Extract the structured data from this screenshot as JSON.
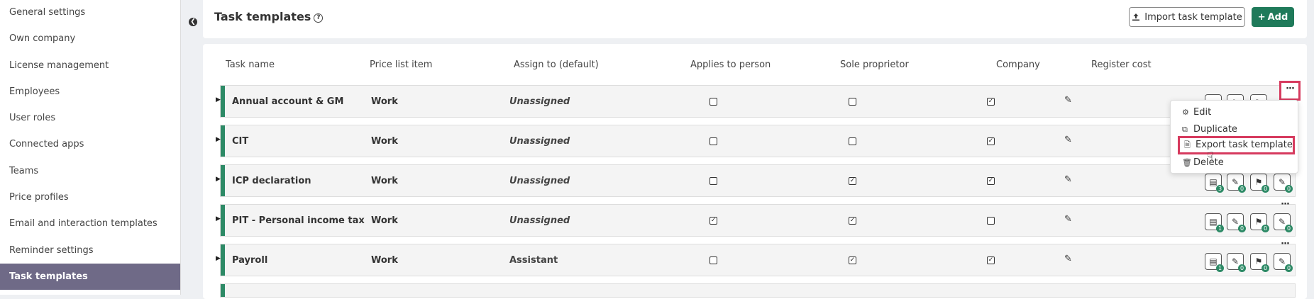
{
  "sidebar": {
    "items": [
      {
        "label": "General settings",
        "active": false
      },
      {
        "label": "Own company",
        "active": false
      },
      {
        "label": "License management",
        "active": false
      },
      {
        "label": "Employees",
        "active": false
      },
      {
        "label": "User roles",
        "active": false
      },
      {
        "label": "Connected apps",
        "active": false
      },
      {
        "label": "Teams",
        "active": false
      },
      {
        "label": "Price profiles",
        "active": false
      },
      {
        "label": "Email and interaction templates",
        "active": false
      },
      {
        "label": "Reminder settings",
        "active": false
      },
      {
        "label": "Task templates",
        "active": true
      }
    ]
  },
  "header": {
    "title": "Task templates",
    "help_icon": "?",
    "import_label": "Import task template",
    "add_label": "Add"
  },
  "table": {
    "columns": [
      "Task name",
      "Price list item",
      "Assign to (default)",
      "Applies to person",
      "Sole proprietor",
      "Company",
      "Register cost"
    ],
    "rows": [
      {
        "name": "Annual account & GM",
        "price": "Work",
        "assign": "Unassigned",
        "assign_italic": true,
        "person": false,
        "sole": false,
        "company": true
      },
      {
        "name": "CIT",
        "price": "Work",
        "assign": "Unassigned",
        "assign_italic": true,
        "person": false,
        "sole": false,
        "company": true
      },
      {
        "name": "ICP declaration",
        "price": "Work",
        "assign": "Unassigned",
        "assign_italic": true,
        "person": false,
        "sole": true,
        "company": true,
        "badges": [
          "3",
          "0",
          "0",
          "0"
        ]
      },
      {
        "name": "PIT - Personal income tax",
        "price": "Work",
        "assign": "Unassigned",
        "assign_italic": true,
        "person": true,
        "sole": true,
        "company": false,
        "badges": [
          "1",
          "0",
          "0",
          "0"
        ]
      },
      {
        "name": "Payroll",
        "price": "Work",
        "assign": "Assistant",
        "assign_italic": false,
        "person": false,
        "sole": true,
        "company": true,
        "badges": [
          "1",
          "0",
          "0",
          "0"
        ]
      }
    ]
  },
  "menu": {
    "items": [
      {
        "label": "Edit",
        "icon": "gear-icon"
      },
      {
        "label": "Duplicate",
        "icon": "copy-icon"
      },
      {
        "label": "Export task template",
        "icon": "document-icon"
      },
      {
        "label": "Delete",
        "icon": "trash-icon"
      }
    ]
  },
  "more_label": "···",
  "colors": {
    "accent": "#2d8a66",
    "active_sidebar": "#6f6a87",
    "add_button": "#1f7a5a",
    "highlight": "#d63a5e"
  }
}
